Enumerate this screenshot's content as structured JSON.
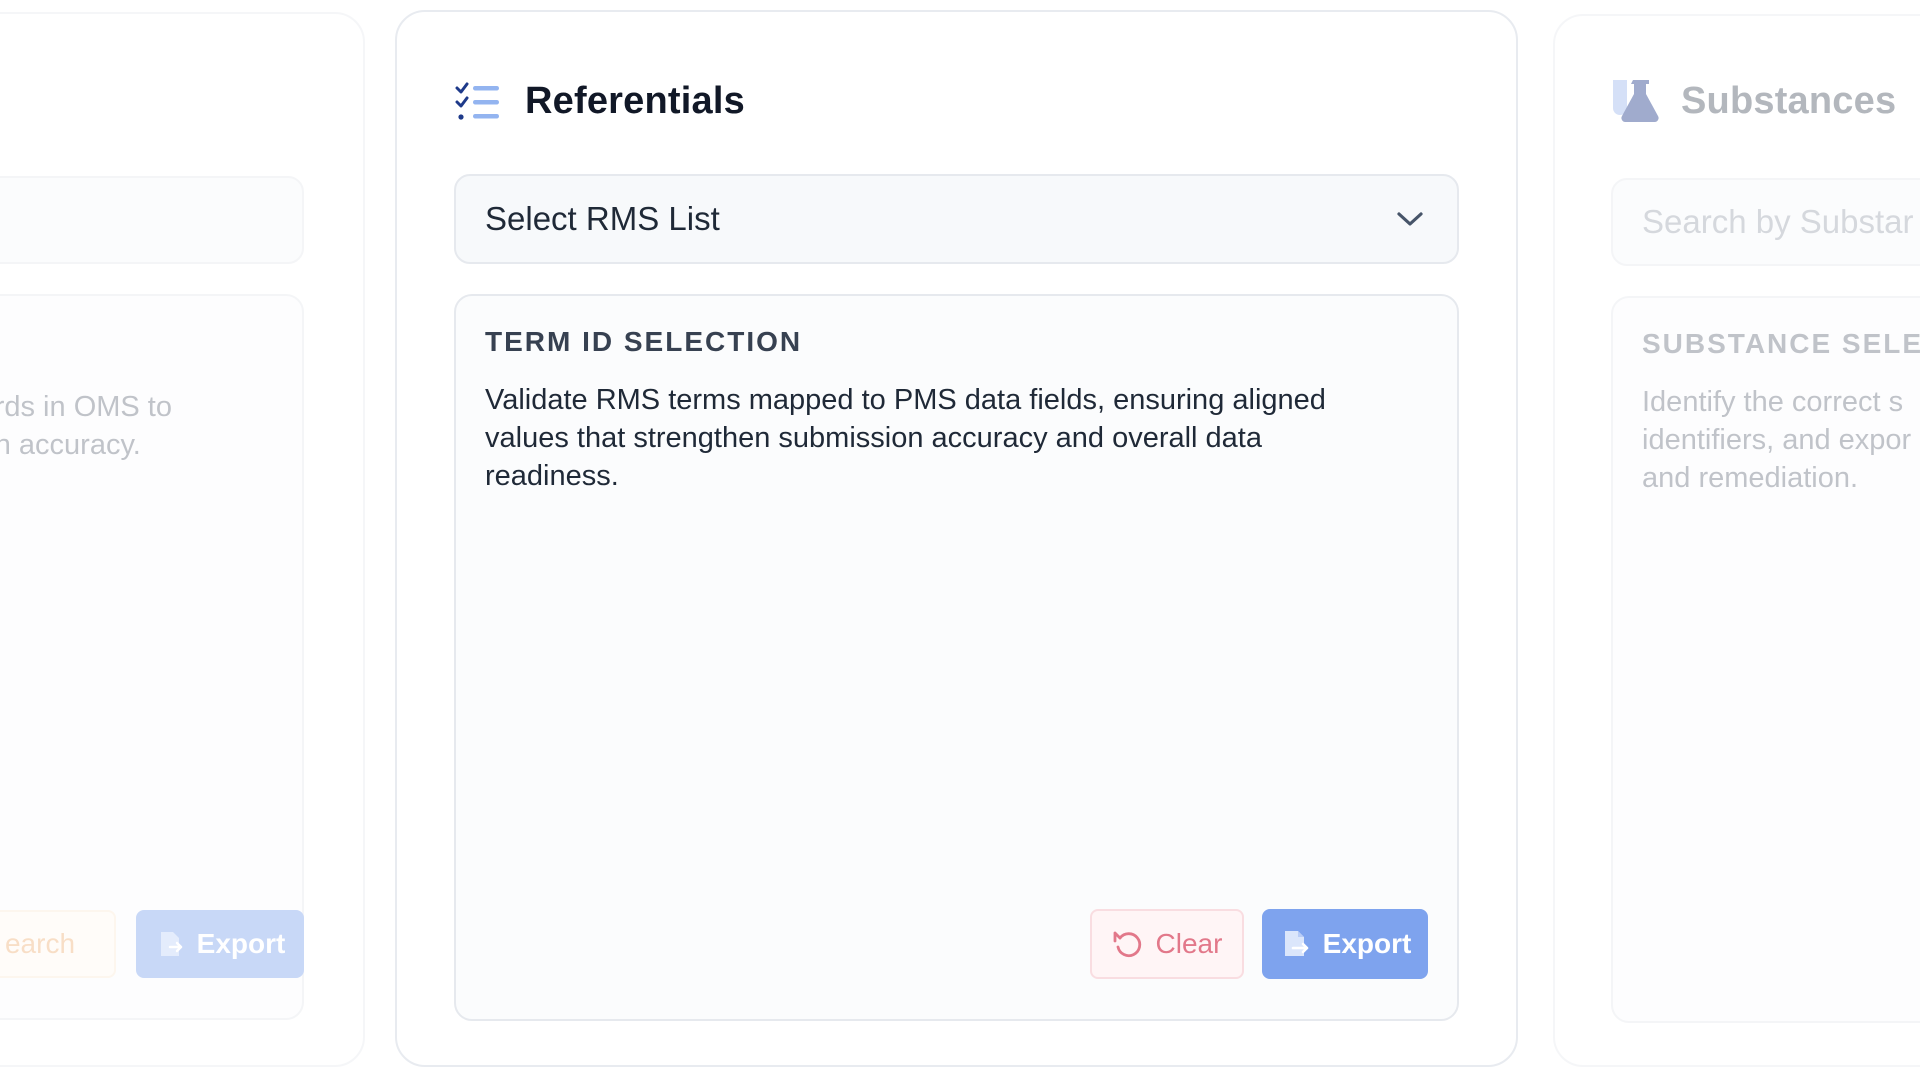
{
  "left_card": {
    "description_line1": "rds in OMS to",
    "description_line2": "n accuracy.",
    "search_button_label": "earch",
    "export_button_label": "Export"
  },
  "center_card": {
    "title": "Referentials",
    "icon": "checklist-icon",
    "select": {
      "value": "Select RMS List",
      "icon": "chevron-down-icon"
    },
    "panel": {
      "heading": "TERM ID SELECTION",
      "description": "Validate RMS terms mapped to PMS data fields, ensuring aligned values that strengthen submission accuracy and overall data readiness."
    },
    "clear_button_label": "Clear",
    "export_button_label": "Export"
  },
  "right_card": {
    "title": "Substances",
    "icon": "flask-icon",
    "search_placeholder": "Search by Substar",
    "panel": {
      "heading": "SUBSTANCE SELEC",
      "description_line1": "Identify the correct s",
      "description_line2": "identifiers, and expor",
      "description_line3": "and remediation."
    }
  },
  "colors": {
    "accent_blue": "#7ea3ee",
    "clear_red": "#e2788a",
    "title_dark": "#111827",
    "border": "#e8ebf0"
  }
}
